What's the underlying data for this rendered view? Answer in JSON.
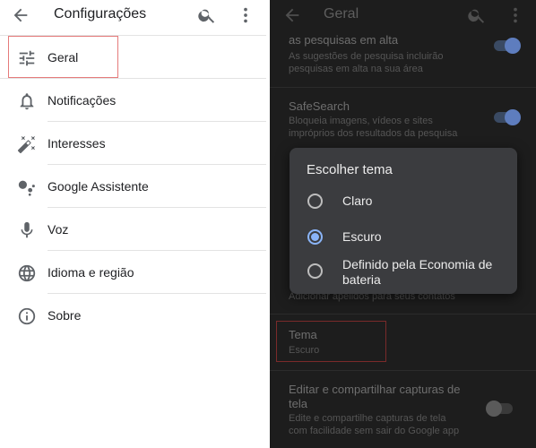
{
  "left": {
    "title": "Configurações",
    "items": [
      {
        "label": "Geral",
        "icon": "tune-icon"
      },
      {
        "label": "Notificações",
        "icon": "bell-icon"
      },
      {
        "label": "Interesses",
        "icon": "magic-wand-icon"
      },
      {
        "label": "Google Assistente",
        "icon": "assistant-icon"
      },
      {
        "label": "Voz",
        "icon": "mic-icon"
      },
      {
        "label": "Idioma e região",
        "icon": "globe-icon"
      },
      {
        "label": "Sobre",
        "icon": "info-icon"
      }
    ],
    "highlighted_item": "Geral"
  },
  "right": {
    "title": "Geral",
    "settings": [
      {
        "title": "as pesquisas em alta",
        "subtitle_1": "As sugestões de pesquisa incluirão",
        "subtitle_2": "pesquisas em alta na sua área",
        "toggle": "on"
      },
      {
        "title": "SafeSearch",
        "subtitle_1": "Bloqueia imagens, vídeos e sites",
        "subtitle_2": "impróprios dos resultados da pesquisa",
        "toggle": "on"
      },
      {
        "hidden_subtitle": "Adicionar apelidos para seus contatos"
      },
      {
        "title": "Tema",
        "subtitle": "Escuro"
      },
      {
        "title_1": "Editar e compartilhar capturas de",
        "title_2": "tela",
        "subtitle_1": "Edite e compartilhe capturas de tela",
        "subtitle_2": "com facilidade sem sair do Google app",
        "toggle": "off"
      }
    ],
    "dialog": {
      "title": "Escolher tema",
      "options": [
        {
          "label": "Claro",
          "selected": false
        },
        {
          "label": "Escuro",
          "selected": true
        },
        {
          "label_1": "Definido pela Economia de",
          "label_2": "bateria",
          "selected": false
        }
      ]
    }
  },
  "colors": {
    "accent": "#8ab4f8",
    "highlight_border": "#e57b7b",
    "dark_bg": "#1d1d1d",
    "dialog_bg": "#3b3c3f"
  }
}
